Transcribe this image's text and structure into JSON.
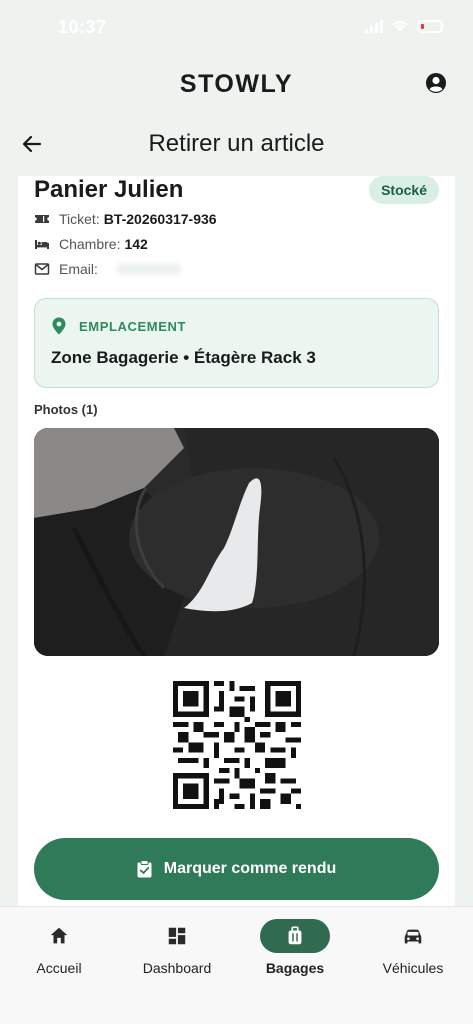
{
  "status_bar": {
    "time": "10:37"
  },
  "app_bar": {
    "title": "STOWLY"
  },
  "header": {
    "title": "Retirer un article"
  },
  "item": {
    "name": "Panier Julien",
    "status": "Stocké",
    "ticket_label": "Ticket:",
    "ticket_value": "BT-20260317-936",
    "room_label": "Chambre:",
    "room_value": "142",
    "email_label": "Email:"
  },
  "location": {
    "heading": "EMPLACEMENT",
    "value": "Zone Bagagerie • Étagère Rack 3"
  },
  "photos": {
    "label": "Photos (1)"
  },
  "cta": {
    "label": "Marquer comme rendu"
  },
  "nav": [
    {
      "label": "Accueil",
      "icon": "home-icon"
    },
    {
      "label": "Dashboard",
      "icon": "dashboard-icon"
    },
    {
      "label": "Bagages",
      "icon": "luggage-icon",
      "active": true
    },
    {
      "label": "Véhicules",
      "icon": "car-icon"
    }
  ],
  "colors": {
    "accent": "#2f7a58",
    "badge_bg": "#d9efe4",
    "location_bg": "#eaf6ef",
    "nav_active": "#2f6a51"
  }
}
